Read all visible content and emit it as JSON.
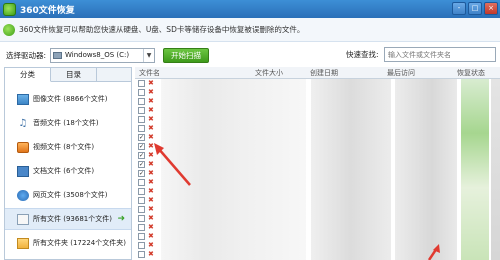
{
  "window": {
    "title": "360文件恢复",
    "controls": [
      "-",
      "□",
      "×"
    ]
  },
  "info": {
    "text": "360文件恢复可以帮助您快速从硬盘、U盘、SD卡等储存设备中恢复被误删除的文件。"
  },
  "toolbar": {
    "drive_label": "选择驱动器:",
    "drive_value": "Windows8_OS (C:)",
    "scan_label": "开始扫描",
    "quick_label": "快速查找:",
    "quick_placeholder": "输入文件或文件夹名"
  },
  "tabs": [
    "分类",
    "目录"
  ],
  "categories": [
    {
      "label": "图像文件 (8866个文件)",
      "icon": "image-icon"
    },
    {
      "label": "音频文件 (18个文件)",
      "icon": "audio-icon"
    },
    {
      "label": "视频文件 (8个文件)",
      "icon": "video-icon"
    },
    {
      "label": "文档文件 (6个文件)",
      "icon": "document-icon"
    },
    {
      "label": "网页文件 (3508个文件)",
      "icon": "web-icon"
    },
    {
      "label": "所有文件 (93681个文件)",
      "icon": "all-files-icon",
      "selected": true
    },
    {
      "label": "所有文件夹 (17224个文件夹)",
      "icon": "folder-icon"
    }
  ],
  "list": {
    "columns": [
      "文件名",
      "文件大小",
      "创建日期",
      "最后访问",
      "恢复状态"
    ],
    "checked_rows": [
      6,
      7,
      8,
      9,
      10
    ]
  },
  "colors": {
    "title_bar": "#2a6fb8",
    "scan_button": "#3e9a1a",
    "delete_mark": "#d23a2a",
    "annotation_arrow": "#e03a30"
  }
}
